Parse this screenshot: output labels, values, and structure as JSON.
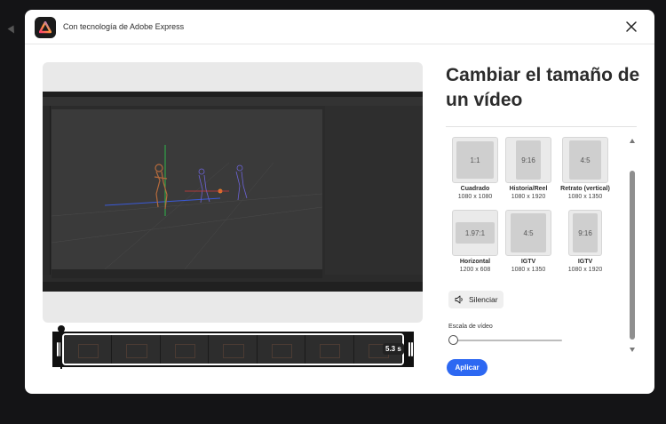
{
  "header": {
    "title": "Con tecnología de Adobe Express"
  },
  "panel": {
    "title": "Cambiar el tamaño de un vídeo",
    "sizes": [
      {
        "ratio": "1:1",
        "name": "Cuadrado",
        "dims": "1080 x 1080"
      },
      {
        "ratio": "9:16",
        "name": "Historia/Reel",
        "dims": "1080 x 1920"
      },
      {
        "ratio": "4:5",
        "name": "Retrato (vertical)",
        "dims": "1080 x 1350"
      },
      {
        "ratio": "1.97:1",
        "name": "Horizontal",
        "dims": "1200 x 608"
      },
      {
        "ratio": "4:5",
        "name": "IGTV",
        "dims": "1080 x 1350"
      },
      {
        "ratio": "9:16",
        "name": "IGTV",
        "dims": "1080 x 1920"
      }
    ],
    "mute_label": "Silenciar",
    "scale_label": "Escala de vídeo",
    "scale_value": 0,
    "apply_label": "Aplicar"
  },
  "timeline": {
    "duration": "5.3 s"
  },
  "colors": {
    "accent": "#2d68f2",
    "logo_bg": "#1b1b1b"
  },
  "icons": [
    "adobe-express-logo-icon",
    "close-icon",
    "speaker-icon",
    "chevron-up-icon",
    "chevron-down-icon"
  ]
}
